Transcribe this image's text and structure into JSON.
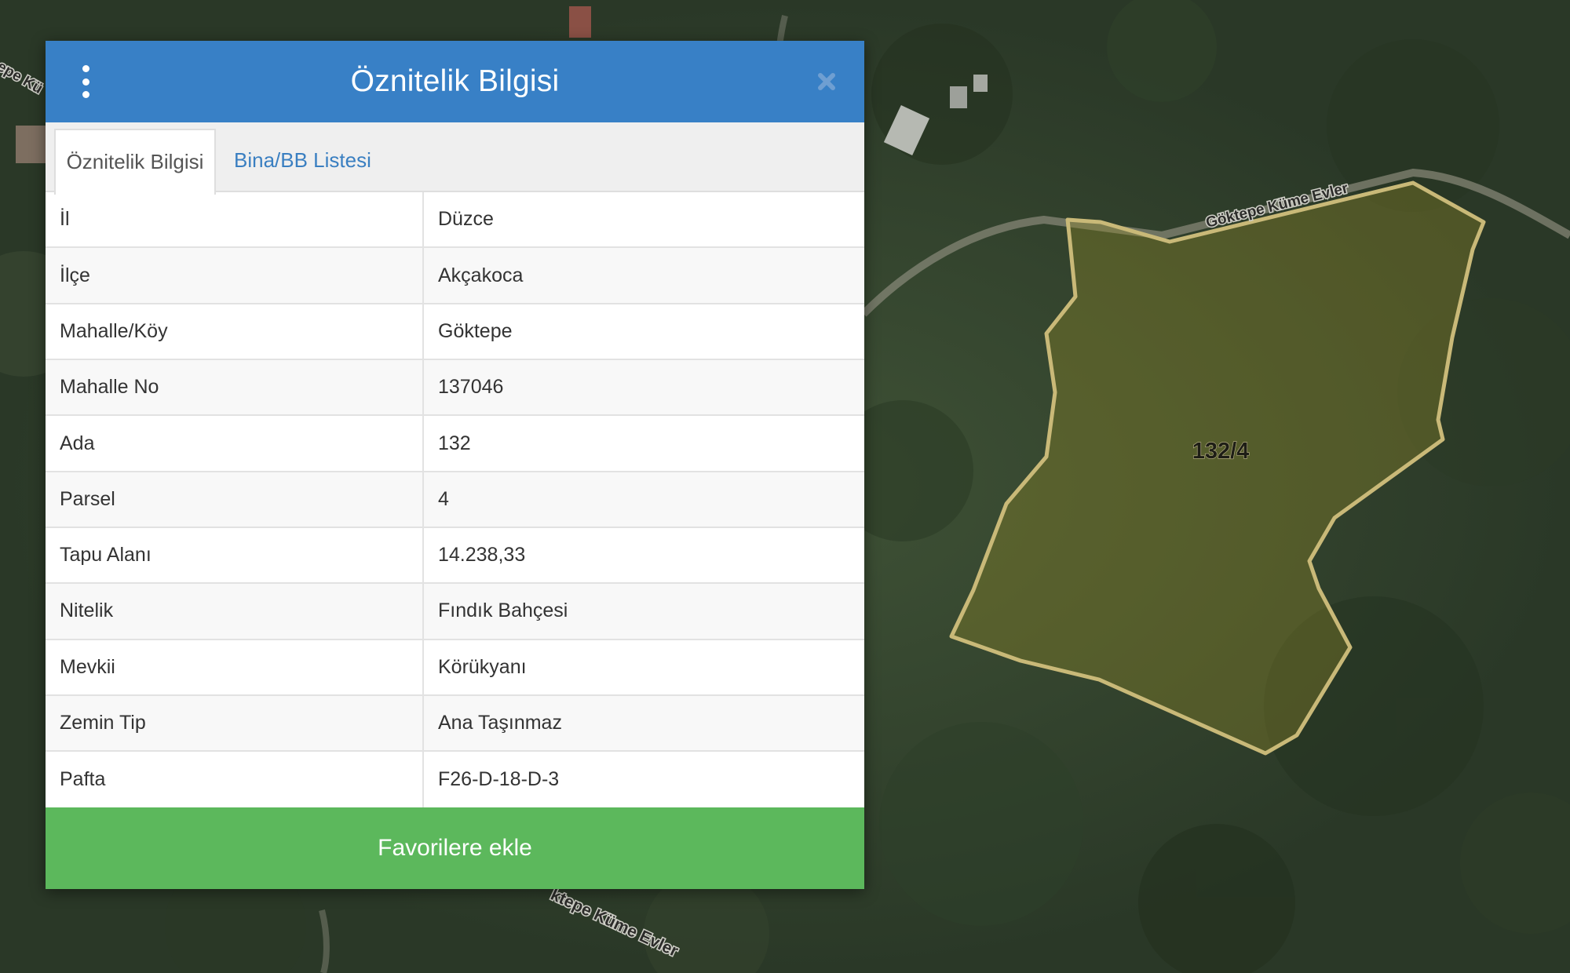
{
  "map": {
    "parcel_label": "132/4",
    "road_label_top": "Göktepe Küme Evler",
    "road_label_bottom": "ktepe Küme Evler",
    "road_label_left": "epe Kü",
    "parcel_outline_color": "#c9b978",
    "parcel_fill_color": "rgba(150,140,40,0.35)"
  },
  "panel": {
    "title": "Öznitelik Bilgisi",
    "menu_icon": "vertical-dots-icon",
    "close_icon": "close-icon",
    "header_color": "#3880c6",
    "tabs": [
      {
        "label": "Öznitelik Bilgisi",
        "active": true
      },
      {
        "label": "Bina/BB Listesi",
        "active": false
      }
    ],
    "rows": [
      {
        "key": "İl",
        "value": "Düzce"
      },
      {
        "key": "İlçe",
        "value": "Akçakoca"
      },
      {
        "key": "Mahalle/Köy",
        "value": "Göktepe"
      },
      {
        "key": "Mahalle No",
        "value": "137046"
      },
      {
        "key": "Ada",
        "value": "132"
      },
      {
        "key": "Parsel",
        "value": "4"
      },
      {
        "key": "Tapu Alanı",
        "value": "14.238,33"
      },
      {
        "key": "Nitelik",
        "value": "Fındık Bahçesi"
      },
      {
        "key": "Mevkii",
        "value": "Körükyanı"
      },
      {
        "key": "Zemin Tip",
        "value": "Ana Taşınmaz"
      },
      {
        "key": "Pafta",
        "value": "F26-D-18-D-3"
      }
    ],
    "favorite_button": "Favorilere ekle",
    "favorite_color": "#5cb85c"
  }
}
